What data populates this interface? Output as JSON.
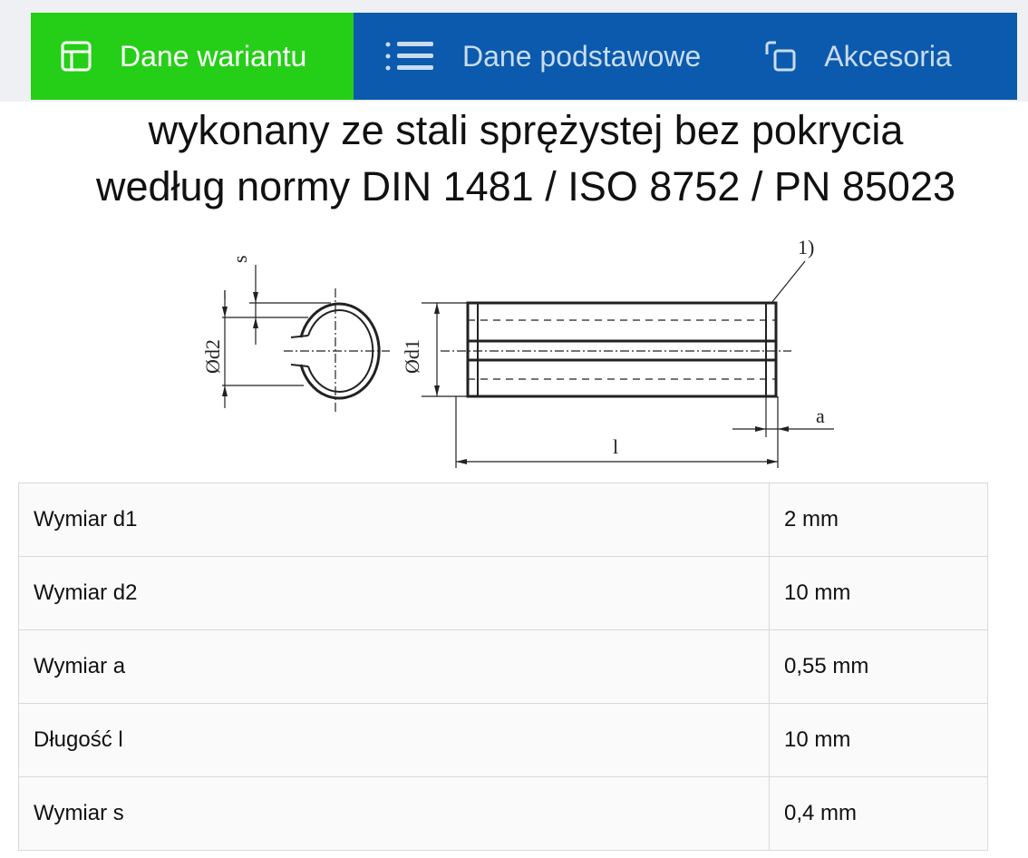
{
  "tabs": [
    {
      "label": "Dane wariantu",
      "icon": "layout-icon",
      "active": true
    },
    {
      "label": "Dane podstawowe",
      "icon": "list-icon",
      "active": false
    },
    {
      "label": "Akcesoria",
      "icon": "copy-icon",
      "active": false
    }
  ],
  "heading": {
    "line1": "wykonany ze stali sprężystej bez pokrycia",
    "line2": "według normy DIN 1481 / ISO 8752 / PN 85023"
  },
  "diagram": {
    "s": "s",
    "d2": "Ød2",
    "d1": "Ød1",
    "note": "1)",
    "a": "a",
    "l": "l"
  },
  "specs": [
    {
      "label": "Wymiar d1",
      "value": "2 mm"
    },
    {
      "label": "Wymiar d2",
      "value": "10 mm"
    },
    {
      "label": "Wymiar a",
      "value": "0,55 mm"
    },
    {
      "label": "Długość l",
      "value": "10 mm"
    },
    {
      "label": "Wymiar s",
      "value": "0,4 mm"
    }
  ],
  "colors": {
    "active_tab": "#26cf17",
    "tab_bar": "#0c5aad"
  }
}
